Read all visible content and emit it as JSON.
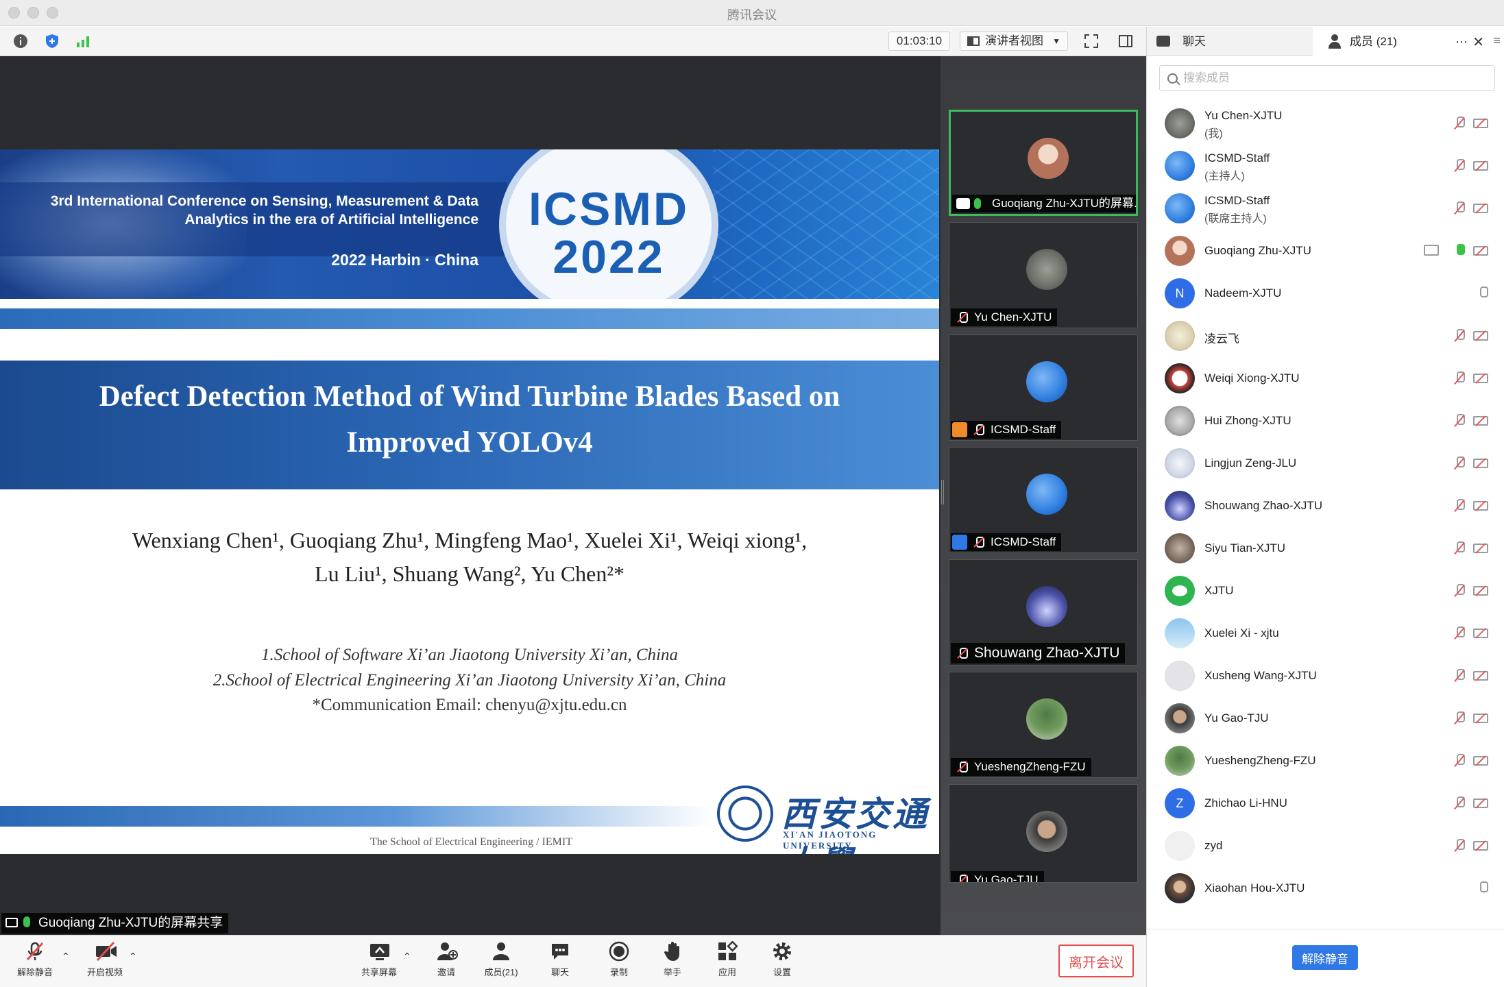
{
  "app": {
    "title": "腾讯会议"
  },
  "toolbar": {
    "timer": "01:03:10",
    "view_mode": "演讲者视图"
  },
  "slide": {
    "banner_line1": "3rd International Conference on Sensing, Measurement & Data",
    "banner_line2": "Analytics in the era of Artificial Intelligence",
    "banner_city": "2022 Harbin · China",
    "logo_top": "ICSMD",
    "logo_bottom": "2022",
    "title_line1": "Defect Detection Method of Wind Turbine Blades Based on",
    "title_line2": "Improved YOLOv4",
    "authors_line1": "Wenxiang Chen¹, Guoqiang Zhu¹, Mingfeng Mao¹, Xuelei Xi¹, Weiqi xiong¹,",
    "authors_line2": "Lu Liu¹, Shuang Wang², Yu Chen²*",
    "affiliation1": "1.School of Software Xi’an Jiaotong University Xi’an, China",
    "affiliation2": "2.School of Electrical Engineering Xi’an Jiaotong University Xi’an, China",
    "email": "*Communication Email: chenyu@xjtu.edu.cn",
    "footer": "The School of Electrical Engineering / IEMIT",
    "university_cn": "西安交通大學",
    "university_en": "XI'AN JIAOTONG UNIVERSITY"
  },
  "share_label": "Guoqiang Zhu-XJTU的屏幕共享",
  "gallery": [
    {
      "name": "Guoqiang Zhu-XJTU的屏幕...",
      "color": "#b5725a"
    },
    {
      "name": "Yu Chen-XJTU",
      "color": "#6b6e68"
    },
    {
      "name": "ICSMD-Staff",
      "color": "#2f7fe0"
    },
    {
      "name": "ICSMD-Staff",
      "color": "#2f7fe0"
    },
    {
      "name": "Shouwang Zhao-XJTU",
      "color": "#4b52a8"
    },
    {
      "name": "YueshengZheng-FZU",
      "color": "#5f8a55"
    },
    {
      "name": "Yu Gao-TJU",
      "color": "#3a3a3a"
    }
  ],
  "panel": {
    "tab_chat": "聊天",
    "tab_members": "成员 (21)",
    "search_placeholder": "搜索成员",
    "unmute_all": "解除静音"
  },
  "members": [
    {
      "name": "Yu Chen-XJTU",
      "role": "(我)",
      "color": "#6b6e68",
      "initial": ""
    },
    {
      "name": "ICSMD-Staff",
      "role": "(主持人)",
      "color": "#2f7fe0",
      "initial": ""
    },
    {
      "name": "ICSMD-Staff",
      "role": "(联席主持人)",
      "color": "#2f7fe0",
      "initial": ""
    },
    {
      "name": "Guoqiang Zhu-XJTU",
      "role": "",
      "color": "#b5725a",
      "initial": ""
    },
    {
      "name": "Nadeem-XJTU",
      "role": "",
      "color": "#2f6de6",
      "initial": "N"
    },
    {
      "name": "凌云飞",
      "role": "",
      "color": "#d8d0b0",
      "initial": ""
    },
    {
      "name": "Weiqi Xiong-XJTU",
      "role": "",
      "color": "#c9453a",
      "initial": ""
    },
    {
      "name": "Hui Zhong-XJTU",
      "role": "",
      "color": "#a8a8a8",
      "initial": ""
    },
    {
      "name": "Lingjun Zeng-JLU",
      "role": "",
      "color": "#cfd6e4",
      "initial": ""
    },
    {
      "name": "Shouwang Zhao-XJTU",
      "role": "",
      "color": "#4b52a8",
      "initial": ""
    },
    {
      "name": "Siyu Tian-XJTU",
      "role": "",
      "color": "#7a6a5e",
      "initial": ""
    },
    {
      "name": "XJTU",
      "role": "",
      "color": "#2fb54f",
      "initial": ""
    },
    {
      "name": "Xuelei Xi - xjtu",
      "role": "",
      "color": "#8cc4ee",
      "initial": ""
    },
    {
      "name": "Xusheng Wang-XJTU",
      "role": "",
      "color": "#e4e4e8",
      "initial": ""
    },
    {
      "name": "Yu Gao-TJU",
      "role": "",
      "color": "#3a3a3a",
      "initial": ""
    },
    {
      "name": "YueshengZheng-FZU",
      "role": "",
      "color": "#5f8a55",
      "initial": ""
    },
    {
      "name": "Zhichao Li-HNU",
      "role": "",
      "color": "#2f6de6",
      "initial": "Z"
    },
    {
      "name": "zyd",
      "role": "",
      "color": "#f0f0f0",
      "initial": ""
    },
    {
      "name": "Xiaohan Hou-XJTU",
      "role": "",
      "color": "#6b5040",
      "initial": ""
    }
  ],
  "bottom": {
    "unmute": "解除静音",
    "start_video": "开启视频",
    "share_screen": "共享屏幕",
    "invite": "邀请",
    "members": "成员(21)",
    "chat": "聊天",
    "record": "录制",
    "raise_hand": "举手",
    "apps": "应用",
    "settings": "设置",
    "leave": "离开会议"
  }
}
